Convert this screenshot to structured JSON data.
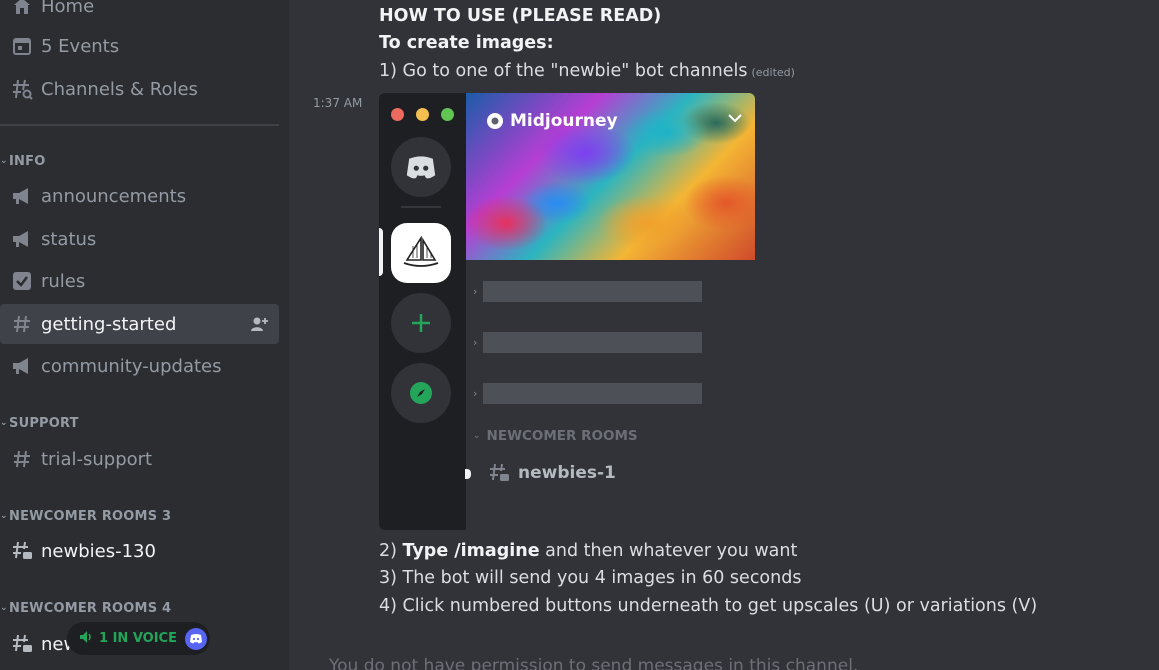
{
  "sidebar": {
    "top_items": [
      {
        "label": "Home",
        "icon": "home-icon"
      },
      {
        "label": "5 Events",
        "icon": "calendar-icon"
      },
      {
        "label": "Channels & Roles",
        "icon": "channel-browse-icon"
      }
    ],
    "categories": [
      {
        "name": "INFO",
        "channels": [
          {
            "label": "announcements",
            "icon": "megaphone-icon"
          },
          {
            "label": "status",
            "icon": "megaphone-icon"
          },
          {
            "label": "rules",
            "icon": "checkbox-icon"
          },
          {
            "label": "getting-started",
            "icon": "hashtag-icon",
            "active": true
          },
          {
            "label": "community-updates",
            "icon": "megaphone-icon"
          }
        ]
      },
      {
        "name": "SUPPORT",
        "channels": [
          {
            "label": "trial-support",
            "icon": "hashtag-icon"
          }
        ]
      },
      {
        "name": "NEWCOMER ROOMS 3",
        "channels": [
          {
            "label": "newbies-130",
            "icon": "threaded-channel-icon"
          }
        ]
      },
      {
        "name": "NEWCOMER ROOMS 4",
        "channels": [
          {
            "label": "new",
            "icon": "threaded-channel-icon"
          }
        ]
      }
    ],
    "voice_pill": {
      "label": "1 IN VOICE",
      "icon": "speaker-icon",
      "badge_icon": "discord-icon"
    }
  },
  "message": {
    "heading": "HOW TO USE (PLEASE READ)",
    "subheading": "To create images:",
    "step1": "1) Go to one of the \"newbie\" bot channels",
    "edited": "(edited)",
    "timestamp": "1:37 AM",
    "step2_prefix": "2) ",
    "step2_bold": "Type /imagine",
    "step2_rest": " and then whatever you want",
    "step3": "3) The bot will send you 4 images in 60 seconds",
    "step4": "4) Click numbered buttons underneath to get upscales (U) or variations (V)"
  },
  "embedded_image": {
    "server_name": "Midjourney",
    "category": "NEWCOMER ROOMS",
    "channel": "newbies-1",
    "colors": {
      "red": "#ed6a5e",
      "yellow": "#f5bf4f",
      "green": "#61c554",
      "plus": "#23a55a"
    }
  },
  "footer": {
    "permission_text": "You do not have permission to send messages in this channel."
  },
  "colors": {
    "sidebar_bg": "#2b2d31",
    "main_bg": "#313338",
    "active_item_bg": "#404249",
    "voice_green": "#23a55a",
    "blurple": "#5865f2"
  }
}
